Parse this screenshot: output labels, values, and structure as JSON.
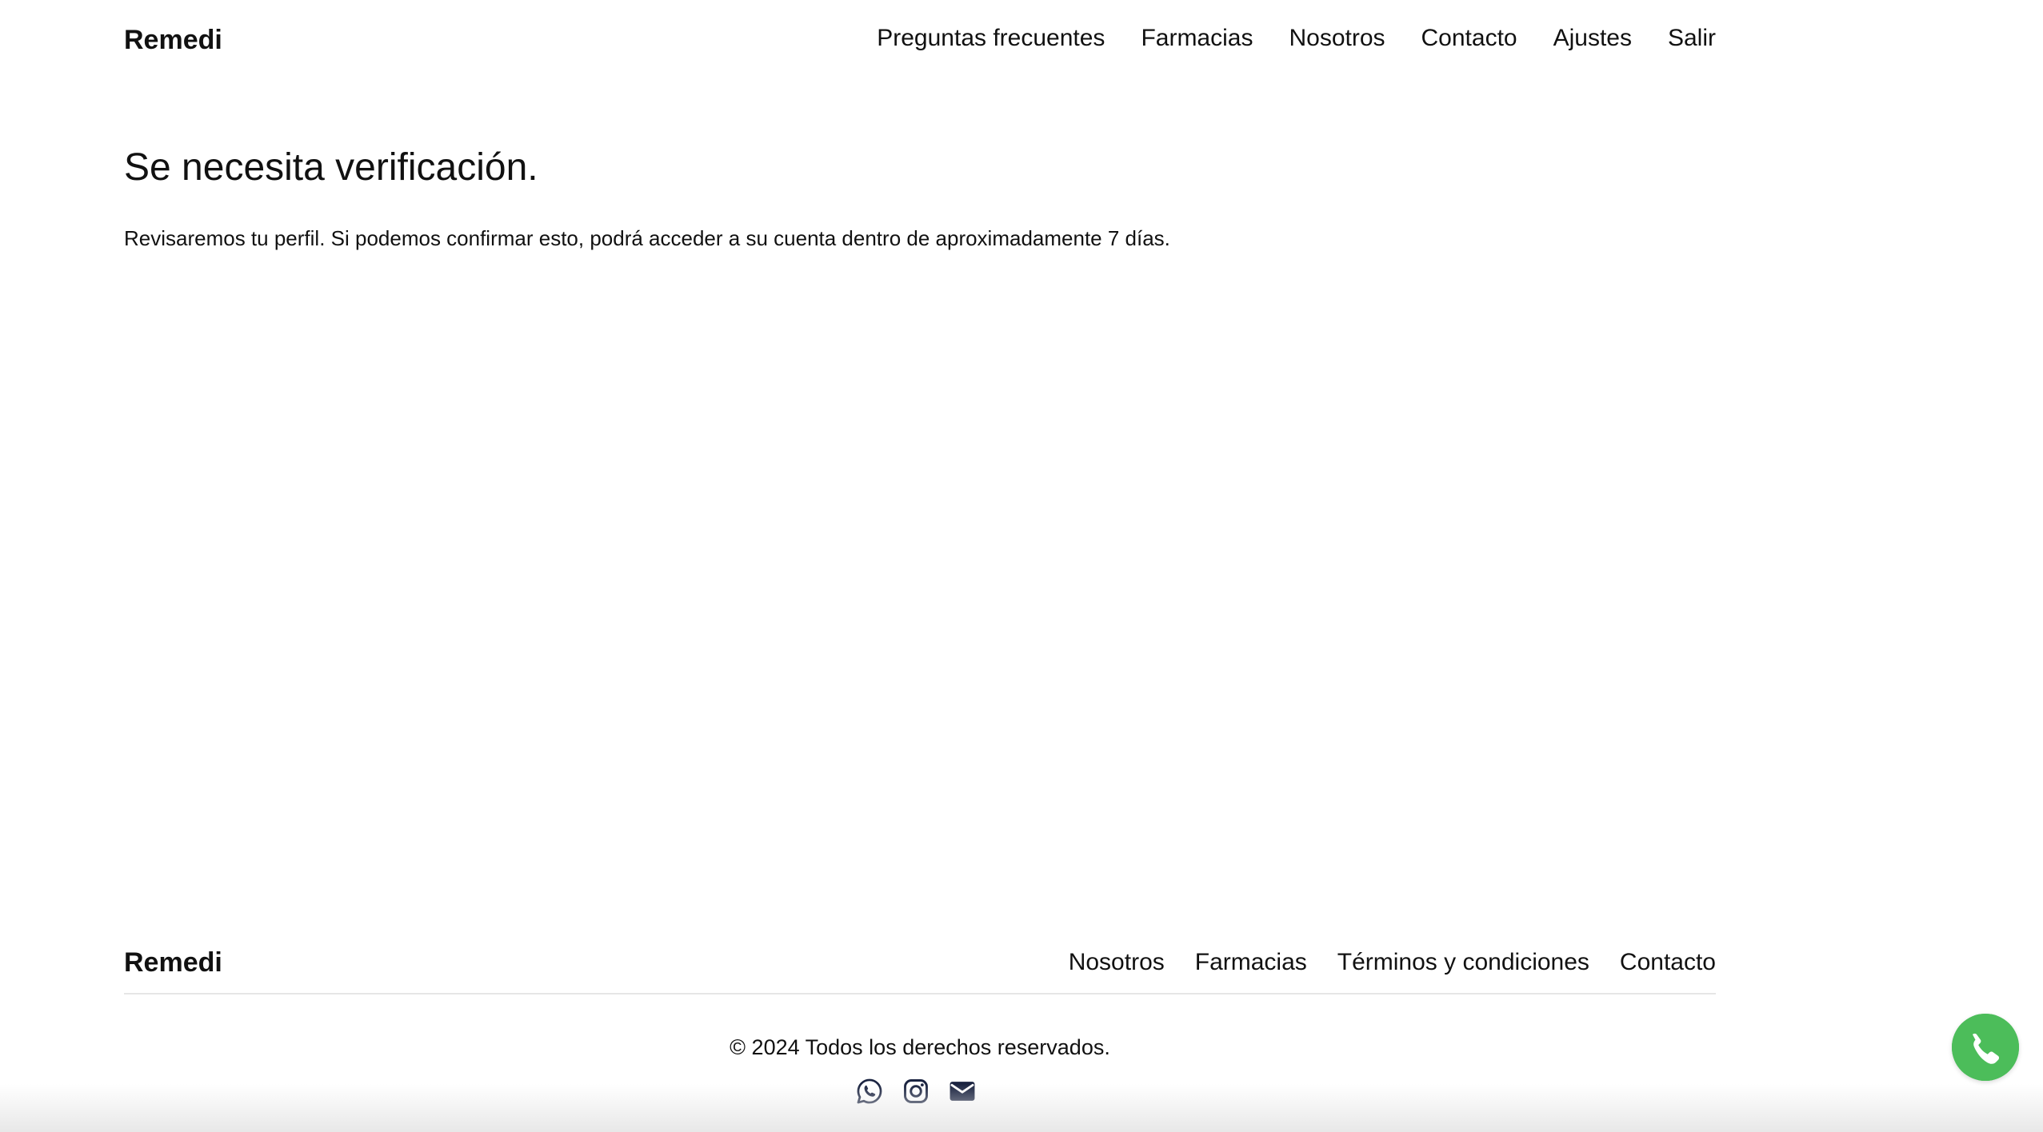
{
  "header": {
    "brand": "Remedi",
    "nav": [
      {
        "label": "Preguntas frecuentes"
      },
      {
        "label": "Farmacias"
      },
      {
        "label": "Nosotros"
      },
      {
        "label": "Contacto"
      },
      {
        "label": "Ajustes"
      },
      {
        "label": "Salir"
      }
    ]
  },
  "main": {
    "title": "Se necesita verificación.",
    "message": "Revisaremos tu perfil. Si podemos confirmar esto, podrá acceder a su cuenta dentro de aproximadamente 7 días."
  },
  "footer": {
    "brand": "Remedi",
    "nav": [
      {
        "label": "Nosotros"
      },
      {
        "label": "Farmacias"
      },
      {
        "label": "Términos y condiciones"
      },
      {
        "label": "Contacto"
      }
    ],
    "copyright": "© 2024 Todos los derechos reservados.",
    "social_icons": [
      "whatsapp-icon",
      "instagram-icon",
      "mail-icon"
    ]
  },
  "floating_button": {
    "icon": "whatsapp-icon",
    "color": "#4cbd5a"
  },
  "colors": {
    "text": "#111111",
    "icon_dark": "#1a2340",
    "divider": "#e6e6e6"
  }
}
